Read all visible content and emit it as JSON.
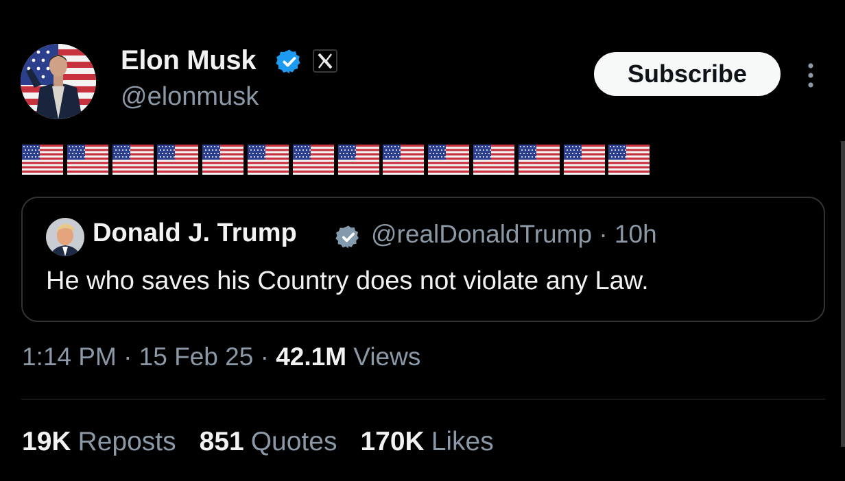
{
  "tweet": {
    "author_name": "Elon Musk",
    "handle": "@elonmusk",
    "verified_icon": "verified-badge-icon",
    "affiliate_icon": "x-logo-icon",
    "subscribe_label": "Subscribe",
    "more_icon": "more-vertical-icon",
    "body_emoji": "🇺🇸🇺🇸🇺🇸🇺🇸🇺🇸🇺🇸🇺🇸🇺🇸🇺🇸🇺🇸🇺🇸🇺🇸🇺🇸🇺🇸",
    "flag_count": 14
  },
  "quoted": {
    "author_name": "Donald J. Trump",
    "handle_time": "@realDonaldTrump · 10h",
    "text": "He who saves his Country does not violate any Law."
  },
  "meta": {
    "time_date": "1:14 PM · 15 Feb 25 · ",
    "views_count": "42.1M",
    "views_label": " Views"
  },
  "stats": {
    "reposts_count": "19K",
    "reposts_label": "Reposts",
    "quotes_count": "851",
    "quotes_label": "Quotes",
    "likes_count": "170K",
    "likes_label": "Likes"
  },
  "colors": {
    "background": "#000000",
    "verified_blue": "#1d9bf0",
    "secondary_text": "#8b98a5",
    "border": "#2f3336"
  }
}
